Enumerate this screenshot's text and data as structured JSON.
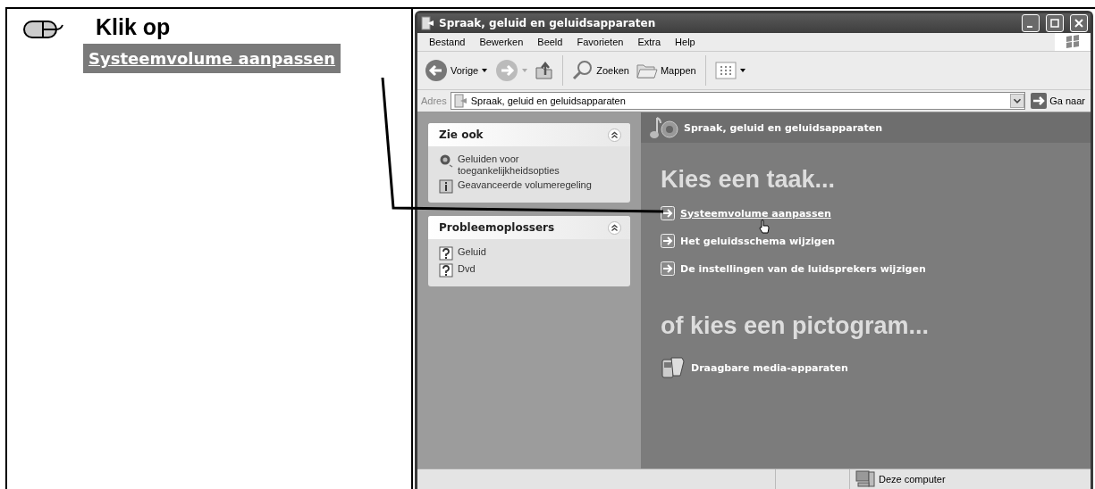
{
  "instruction": {
    "title": "Klik op",
    "link": "Systeemvolume aanpassen"
  },
  "window": {
    "title": "Spraak, geluid en geluidsapparaten"
  },
  "menu": [
    "Bestand",
    "Bewerken",
    "Beeld",
    "Favorieten",
    "Extra",
    "Help"
  ],
  "toolbar": {
    "back": "Vorige",
    "search": "Zoeken",
    "folders": "Mappen"
  },
  "address": {
    "label": "Adres",
    "value": "Spraak, geluid en geluidsapparaten",
    "go": "Ga naar"
  },
  "sidebar": {
    "panels": [
      {
        "title": "Zie ook",
        "expanded": true,
        "items": [
          {
            "label": "Geluiden voor toegankelijkheidsopties",
            "kind": "sound"
          },
          {
            "label": "Geavanceerde volumeregeling",
            "kind": "info"
          }
        ]
      },
      {
        "title": "Probleemoplossers",
        "expanded": true,
        "items": [
          {
            "label": "Geluid",
            "kind": "help"
          },
          {
            "label": "Dvd",
            "kind": "help"
          }
        ]
      }
    ]
  },
  "content": {
    "header": "Spraak, geluid en geluidsapparaten",
    "task_heading": "Kies een taak...",
    "tasks": [
      {
        "label": "Systeemvolume aanpassen",
        "hovered": true
      },
      {
        "label": "Het geluidsschema wijzigen",
        "hovered": false
      },
      {
        "label": "De instellingen van de luidsprekers wijzigen",
        "hovered": false
      }
    ],
    "icon_heading": "of kies een pictogram...",
    "icons": [
      {
        "label": "Draagbare media-apparaten"
      }
    ]
  },
  "status_bar": {
    "zone": "Deze computer"
  }
}
